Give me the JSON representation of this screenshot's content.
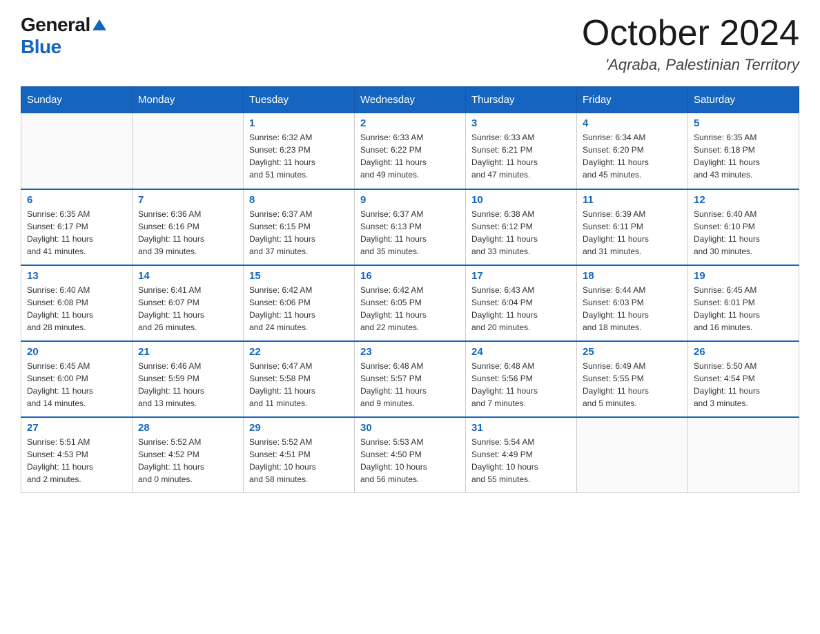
{
  "header": {
    "logo_general": "General",
    "logo_blue": "Blue",
    "month_title": "October 2024",
    "location": "'Aqraba, Palestinian Territory"
  },
  "days_of_week": [
    "Sunday",
    "Monday",
    "Tuesday",
    "Wednesday",
    "Thursday",
    "Friday",
    "Saturday"
  ],
  "weeks": [
    [
      {
        "day": "",
        "info": ""
      },
      {
        "day": "",
        "info": ""
      },
      {
        "day": "1",
        "info": "Sunrise: 6:32 AM\nSunset: 6:23 PM\nDaylight: 11 hours\nand 51 minutes."
      },
      {
        "day": "2",
        "info": "Sunrise: 6:33 AM\nSunset: 6:22 PM\nDaylight: 11 hours\nand 49 minutes."
      },
      {
        "day": "3",
        "info": "Sunrise: 6:33 AM\nSunset: 6:21 PM\nDaylight: 11 hours\nand 47 minutes."
      },
      {
        "day": "4",
        "info": "Sunrise: 6:34 AM\nSunset: 6:20 PM\nDaylight: 11 hours\nand 45 minutes."
      },
      {
        "day": "5",
        "info": "Sunrise: 6:35 AM\nSunset: 6:18 PM\nDaylight: 11 hours\nand 43 minutes."
      }
    ],
    [
      {
        "day": "6",
        "info": "Sunrise: 6:35 AM\nSunset: 6:17 PM\nDaylight: 11 hours\nand 41 minutes."
      },
      {
        "day": "7",
        "info": "Sunrise: 6:36 AM\nSunset: 6:16 PM\nDaylight: 11 hours\nand 39 minutes."
      },
      {
        "day": "8",
        "info": "Sunrise: 6:37 AM\nSunset: 6:15 PM\nDaylight: 11 hours\nand 37 minutes."
      },
      {
        "day": "9",
        "info": "Sunrise: 6:37 AM\nSunset: 6:13 PM\nDaylight: 11 hours\nand 35 minutes."
      },
      {
        "day": "10",
        "info": "Sunrise: 6:38 AM\nSunset: 6:12 PM\nDaylight: 11 hours\nand 33 minutes."
      },
      {
        "day": "11",
        "info": "Sunrise: 6:39 AM\nSunset: 6:11 PM\nDaylight: 11 hours\nand 31 minutes."
      },
      {
        "day": "12",
        "info": "Sunrise: 6:40 AM\nSunset: 6:10 PM\nDaylight: 11 hours\nand 30 minutes."
      }
    ],
    [
      {
        "day": "13",
        "info": "Sunrise: 6:40 AM\nSunset: 6:08 PM\nDaylight: 11 hours\nand 28 minutes."
      },
      {
        "day": "14",
        "info": "Sunrise: 6:41 AM\nSunset: 6:07 PM\nDaylight: 11 hours\nand 26 minutes."
      },
      {
        "day": "15",
        "info": "Sunrise: 6:42 AM\nSunset: 6:06 PM\nDaylight: 11 hours\nand 24 minutes."
      },
      {
        "day": "16",
        "info": "Sunrise: 6:42 AM\nSunset: 6:05 PM\nDaylight: 11 hours\nand 22 minutes."
      },
      {
        "day": "17",
        "info": "Sunrise: 6:43 AM\nSunset: 6:04 PM\nDaylight: 11 hours\nand 20 minutes."
      },
      {
        "day": "18",
        "info": "Sunrise: 6:44 AM\nSunset: 6:03 PM\nDaylight: 11 hours\nand 18 minutes."
      },
      {
        "day": "19",
        "info": "Sunrise: 6:45 AM\nSunset: 6:01 PM\nDaylight: 11 hours\nand 16 minutes."
      }
    ],
    [
      {
        "day": "20",
        "info": "Sunrise: 6:45 AM\nSunset: 6:00 PM\nDaylight: 11 hours\nand 14 minutes."
      },
      {
        "day": "21",
        "info": "Sunrise: 6:46 AM\nSunset: 5:59 PM\nDaylight: 11 hours\nand 13 minutes."
      },
      {
        "day": "22",
        "info": "Sunrise: 6:47 AM\nSunset: 5:58 PM\nDaylight: 11 hours\nand 11 minutes."
      },
      {
        "day": "23",
        "info": "Sunrise: 6:48 AM\nSunset: 5:57 PM\nDaylight: 11 hours\nand 9 minutes."
      },
      {
        "day": "24",
        "info": "Sunrise: 6:48 AM\nSunset: 5:56 PM\nDaylight: 11 hours\nand 7 minutes."
      },
      {
        "day": "25",
        "info": "Sunrise: 6:49 AM\nSunset: 5:55 PM\nDaylight: 11 hours\nand 5 minutes."
      },
      {
        "day": "26",
        "info": "Sunrise: 5:50 AM\nSunset: 4:54 PM\nDaylight: 11 hours\nand 3 minutes."
      }
    ],
    [
      {
        "day": "27",
        "info": "Sunrise: 5:51 AM\nSunset: 4:53 PM\nDaylight: 11 hours\nand 2 minutes."
      },
      {
        "day": "28",
        "info": "Sunrise: 5:52 AM\nSunset: 4:52 PM\nDaylight: 11 hours\nand 0 minutes."
      },
      {
        "day": "29",
        "info": "Sunrise: 5:52 AM\nSunset: 4:51 PM\nDaylight: 10 hours\nand 58 minutes."
      },
      {
        "day": "30",
        "info": "Sunrise: 5:53 AM\nSunset: 4:50 PM\nDaylight: 10 hours\nand 56 minutes."
      },
      {
        "day": "31",
        "info": "Sunrise: 5:54 AM\nSunset: 4:49 PM\nDaylight: 10 hours\nand 55 minutes."
      },
      {
        "day": "",
        "info": ""
      },
      {
        "day": "",
        "info": ""
      }
    ]
  ]
}
